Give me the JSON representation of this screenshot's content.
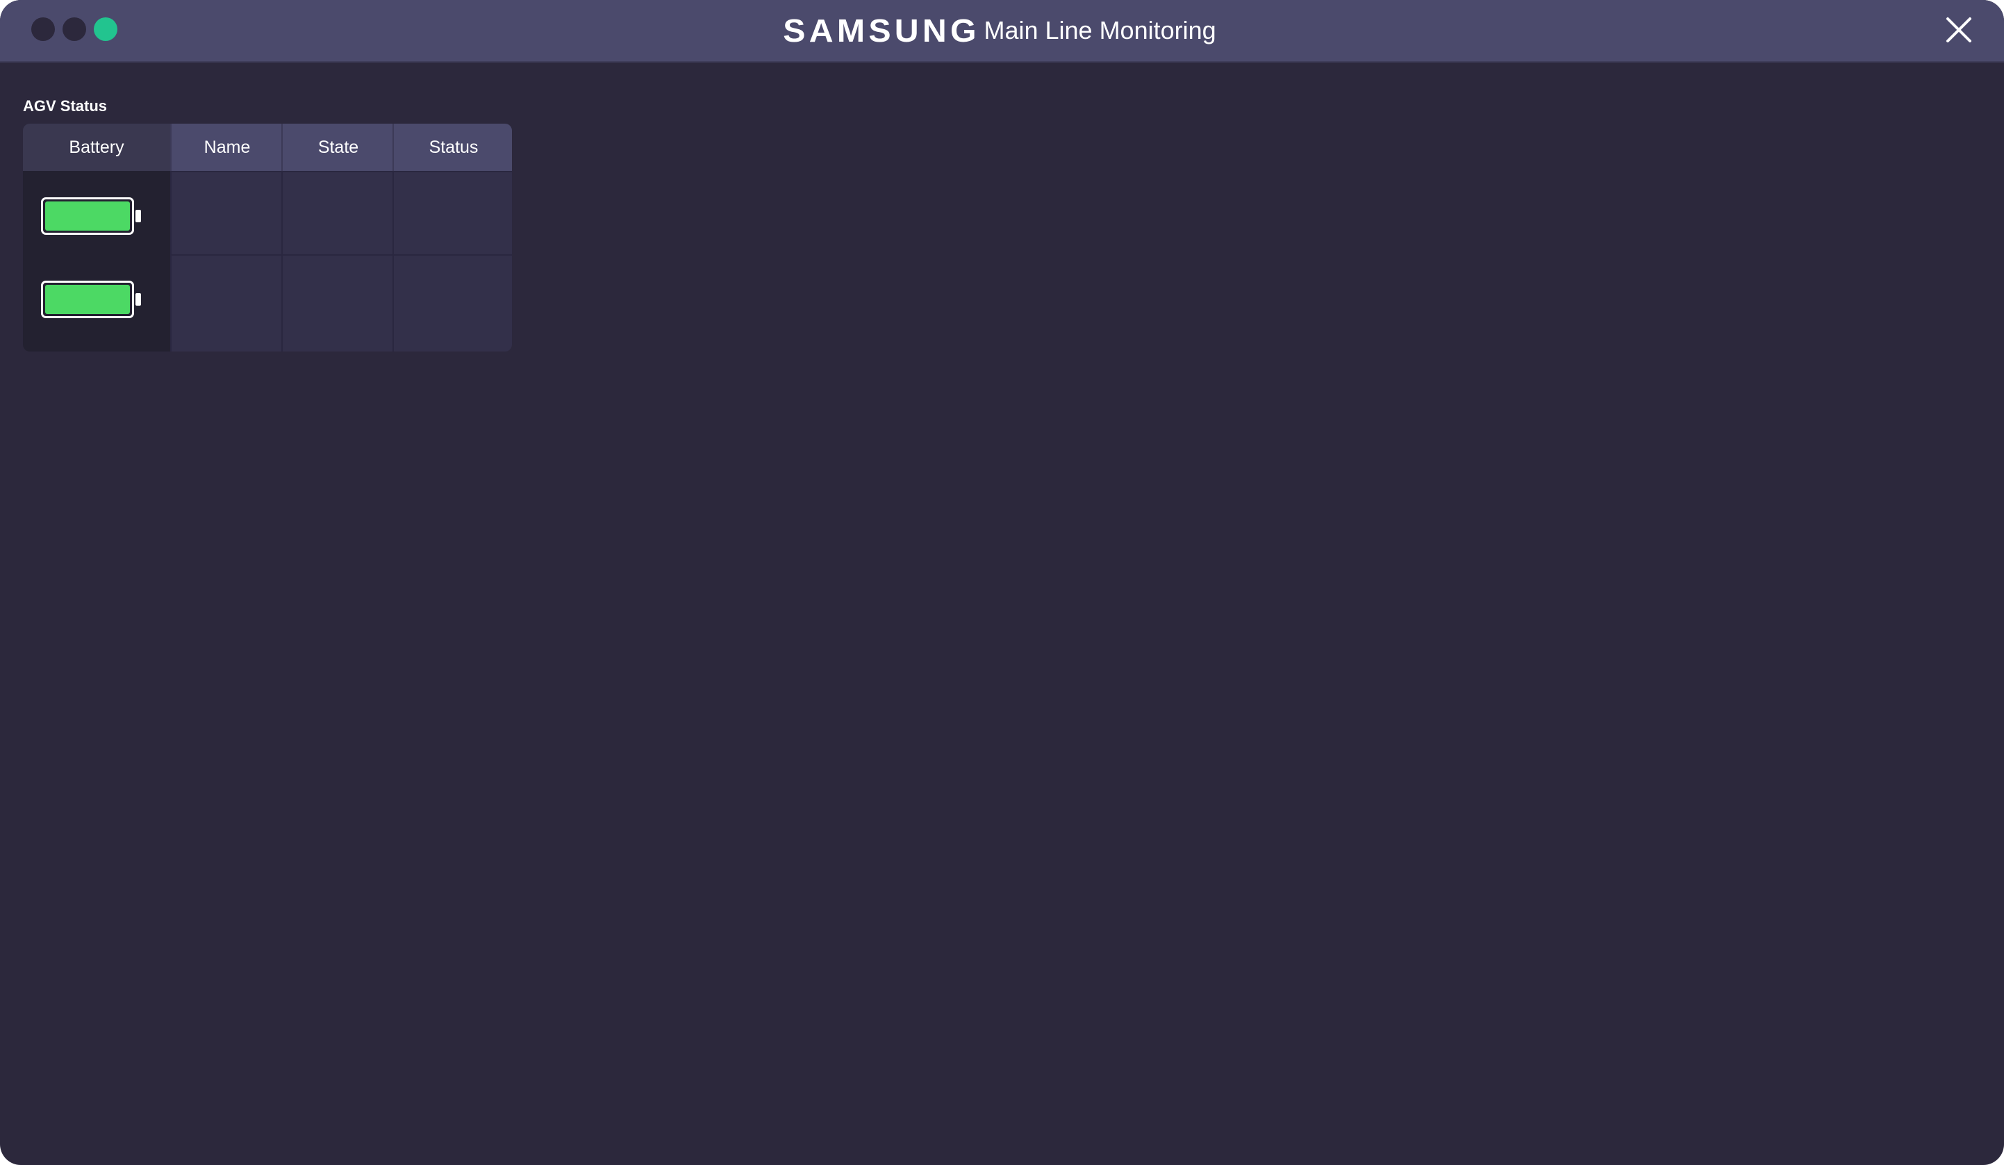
{
  "window": {
    "brand": "SAMSUNG",
    "title": "Main Line Monitoring",
    "accent_color": "#22c48f"
  },
  "agv_status": {
    "section_title": "AGV Status",
    "columns": [
      "Battery",
      "Name",
      "State",
      "Status"
    ],
    "rows": [
      {
        "battery_level": 1.0,
        "name": "",
        "state": "",
        "status": ""
      },
      {
        "battery_level": 1.0,
        "name": "",
        "state": "",
        "status": ""
      }
    ],
    "battery_color": "#4cd964"
  }
}
